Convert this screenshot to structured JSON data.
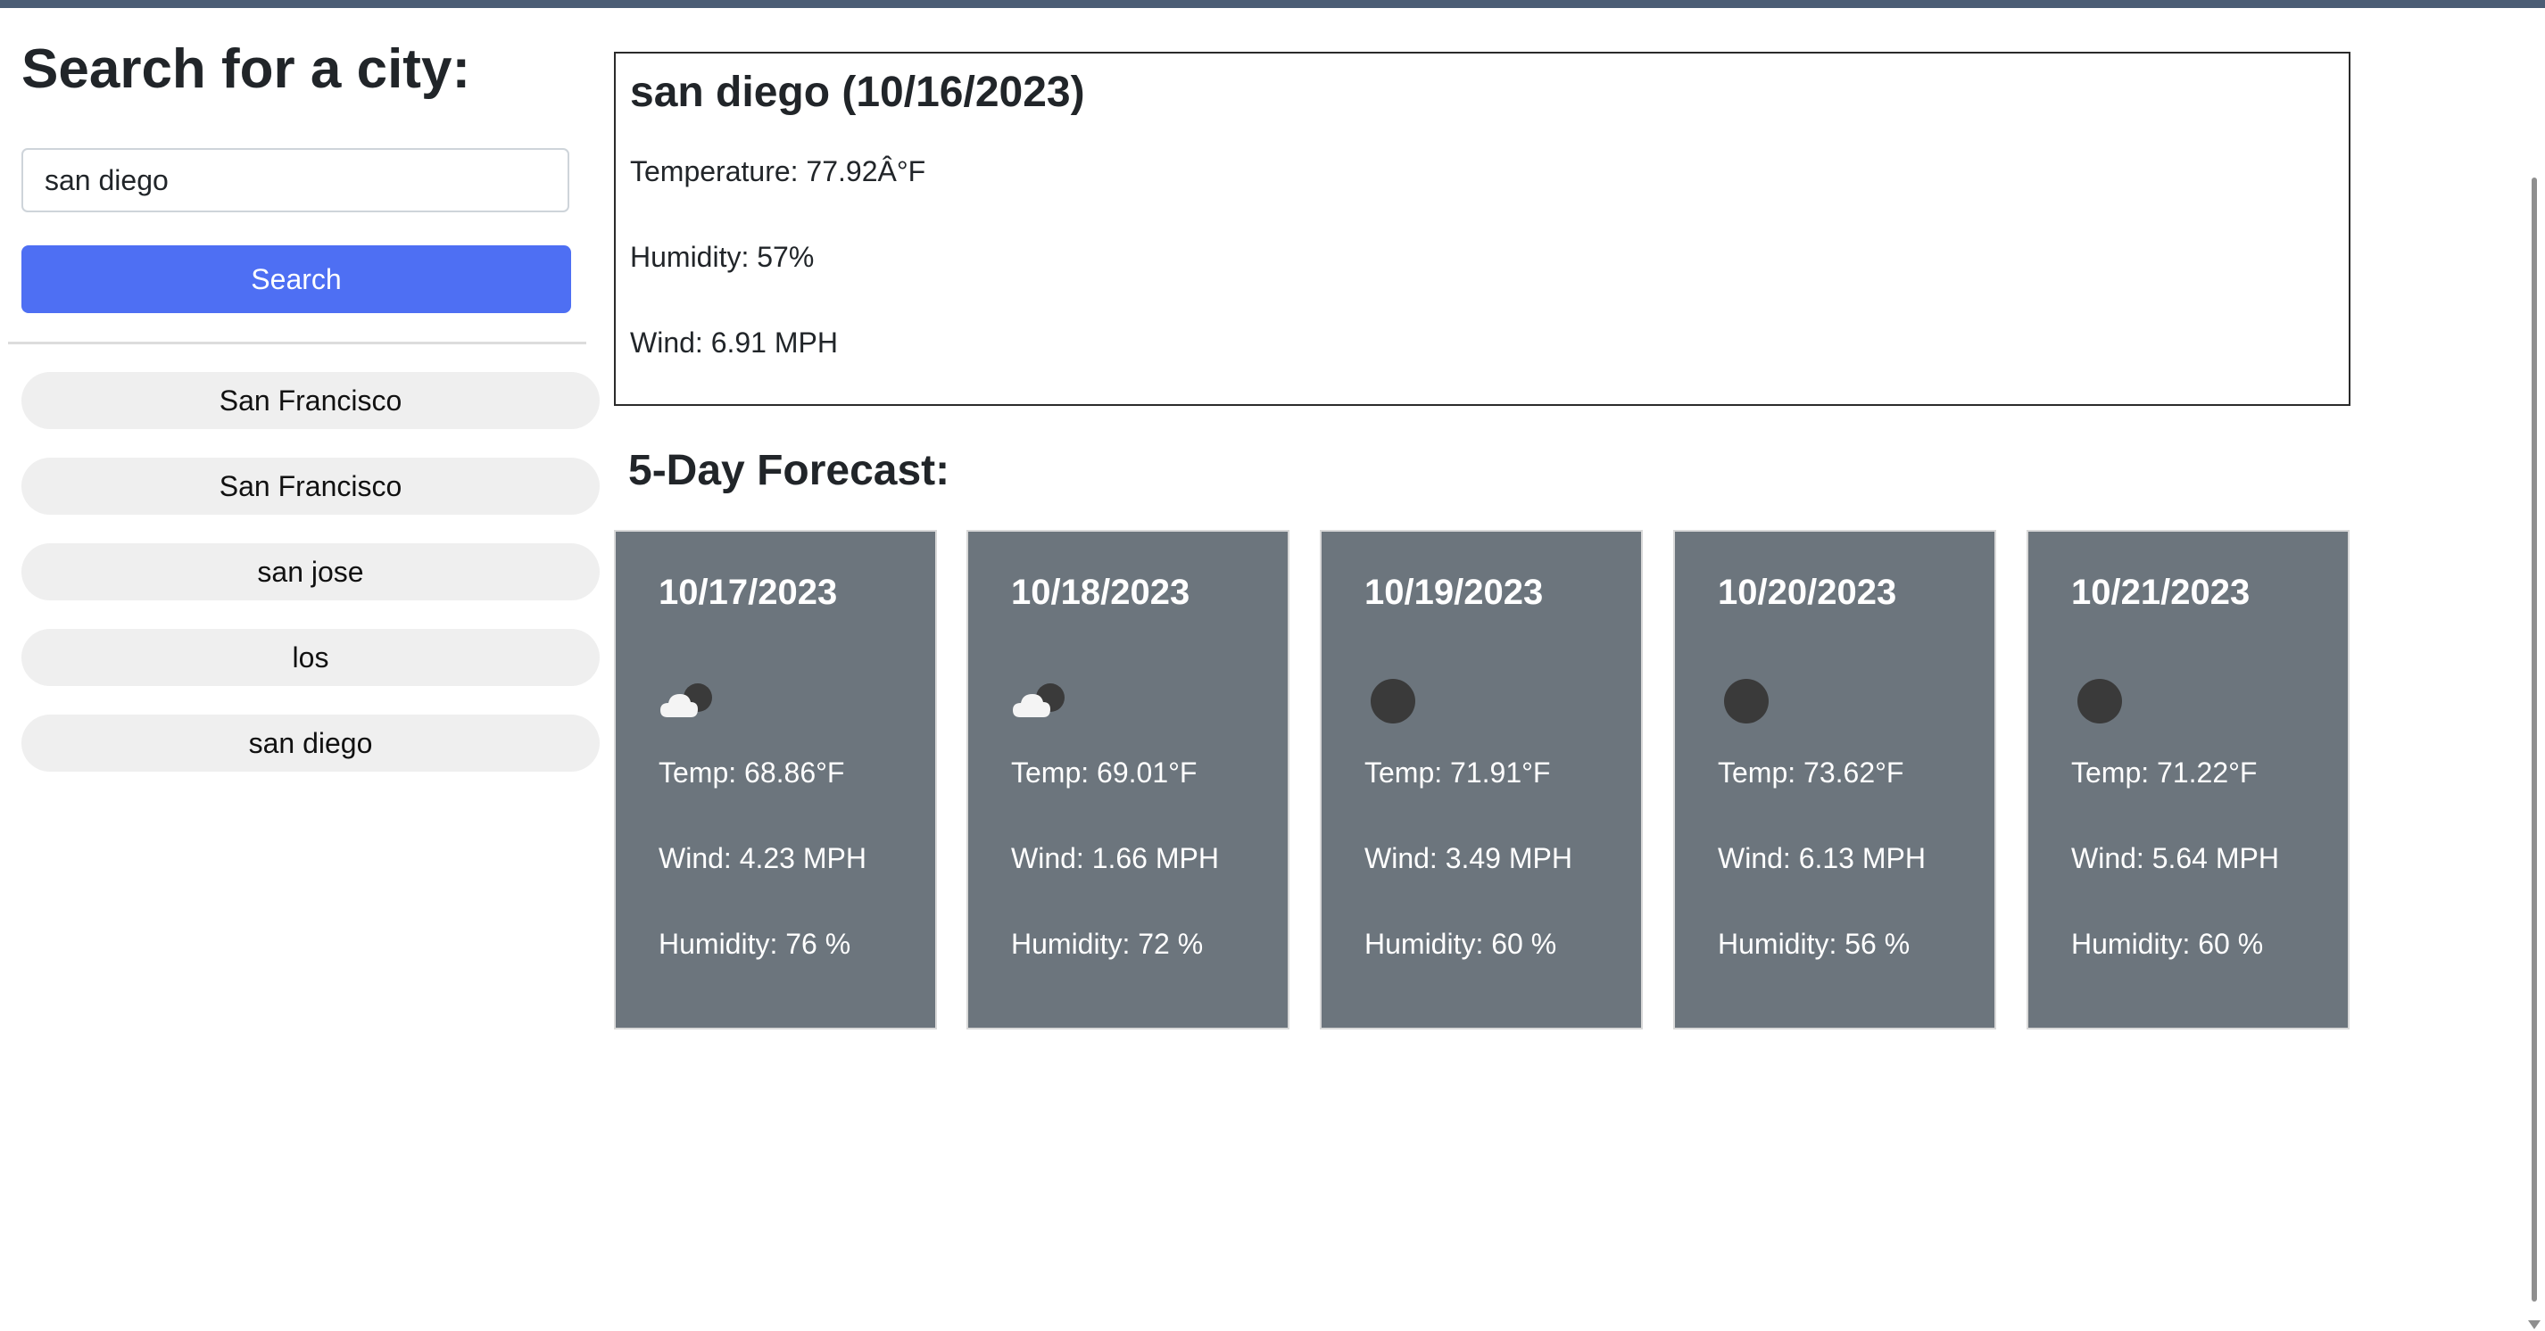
{
  "sidebar": {
    "title": "Search for a city:",
    "search_value": "san diego",
    "search_button": "Search",
    "history": [
      "San Francisco",
      "San Francisco",
      "san jose",
      "los",
      "san diego"
    ]
  },
  "current": {
    "heading": "san diego (10/16/2023)",
    "temperature": "Temperature: 77.92Â°F",
    "humidity": "Humidity: 57%",
    "wind": "Wind: 6.91 MPH"
  },
  "forecast": {
    "title": "5-Day Forecast:",
    "days": [
      {
        "date": "10/17/2023",
        "icon": "partly-cloudy-night-icon",
        "temp": "Temp: 68.86°F",
        "wind": "Wind: 4.23 MPH",
        "humidity": "Humidity: 76 %"
      },
      {
        "date": "10/18/2023",
        "icon": "partly-cloudy-night-icon",
        "temp": "Temp: 69.01°F",
        "wind": "Wind: 1.66 MPH",
        "humidity": "Humidity: 72 %"
      },
      {
        "date": "10/19/2023",
        "icon": "clear-night-icon",
        "temp": "Temp: 71.91°F",
        "wind": "Wind: 3.49 MPH",
        "humidity": "Humidity: 60 %"
      },
      {
        "date": "10/20/2023",
        "icon": "clear-night-icon",
        "temp": "Temp: 73.62°F",
        "wind": "Wind: 6.13 MPH",
        "humidity": "Humidity: 56 %"
      },
      {
        "date": "10/21/2023",
        "icon": "clear-night-icon",
        "temp": "Temp: 71.22°F",
        "wind": "Wind: 5.64 MPH",
        "humidity": "Humidity: 60 %"
      }
    ]
  },
  "colors": {
    "top_bar": "#4b5d75",
    "search_button": "#4e6ff3",
    "card_background": "#6c757d",
    "history_pill": "#efefef"
  }
}
